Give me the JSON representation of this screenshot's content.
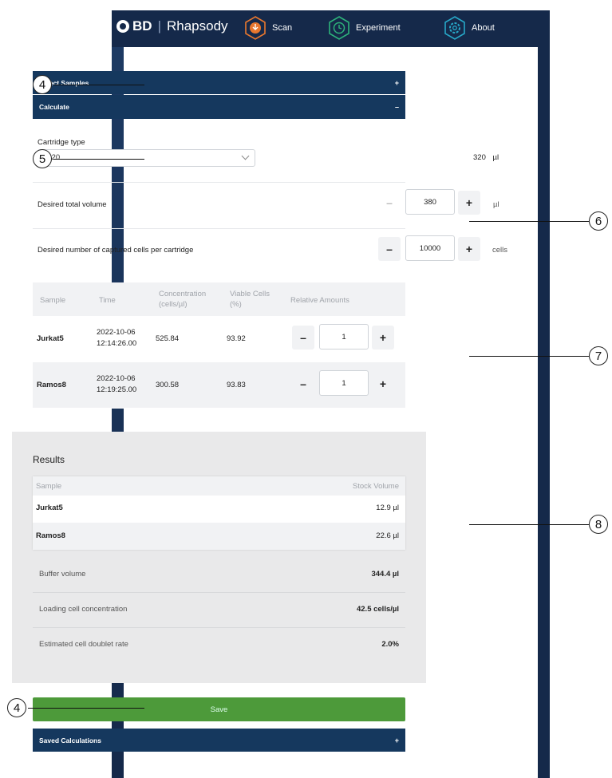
{
  "header": {
    "brand_bd": "BD",
    "brand_sep": "|",
    "brand_name": "Rhapsody",
    "nav": [
      {
        "label": "Scan",
        "color": "#e8772e",
        "icon": "scan-icon"
      },
      {
        "label": "Experiment",
        "color": "#2db37a",
        "icon": "experiment-icon"
      },
      {
        "label": "About",
        "color": "#27a7c7",
        "icon": "gear-icon"
      }
    ]
  },
  "accordion": {
    "select_samples": {
      "label": "Select Samples",
      "sign": "+"
    },
    "calculate": {
      "label": "Calculate",
      "sign": "–"
    },
    "saved_calculations": {
      "label": "Saved Calculations",
      "sign": "+"
    }
  },
  "calculate": {
    "cartridge_label": "Cartridge type",
    "cartridge_value": "0120",
    "cartridge_volume": "320",
    "cartridge_unit": "µl",
    "total_volume_label": "Desired total volume",
    "total_volume_minus": "–",
    "total_volume_value": "380",
    "total_volume_plus": "+",
    "total_volume_unit": "µl",
    "cells_label": "Desired number of captured cells per cartridge",
    "cells_minus": "–",
    "cells_value": "10000",
    "cells_plus": "+",
    "cells_unit": "cells"
  },
  "samples_table": {
    "headers": {
      "sample": "Sample",
      "time": "Time",
      "concentration_1": "Concentration",
      "concentration_2": "(cells/µl)",
      "viable_1": "Viable Cells",
      "viable_2": "(%)",
      "relative": "Relative Amounts"
    },
    "rows": [
      {
        "sample": "Jurkat5",
        "date": "2022-10-06",
        "time": "12:14:26.00",
        "concentration": "525.84",
        "viable": "93.92",
        "minus": "–",
        "amount": "1",
        "plus": "+"
      },
      {
        "sample": "Ramos8",
        "date": "2022-10-06",
        "time": "12:19:25.00",
        "concentration": "300.58",
        "viable": "93.83",
        "minus": "–",
        "amount": "1",
        "plus": "+"
      }
    ]
  },
  "results": {
    "title": "Results",
    "headers": {
      "sample": "Sample",
      "stock": "Stock Volume"
    },
    "rows": [
      {
        "sample": "Jurkat5",
        "stock": "12.9 µl"
      },
      {
        "sample": "Ramos8",
        "stock": "22.6 µl"
      }
    ],
    "buffer_label": "Buffer volume",
    "buffer_value": "344.4 µl",
    "loading_label": "Loading cell concentration",
    "loading_value": "42.5 cells/µl",
    "doublet_label": "Estimated cell doublet rate",
    "doublet_value": "2.0%"
  },
  "save_label": "Save",
  "callouts": {
    "c4_top": "4",
    "c5": "5",
    "c6": "6",
    "c7": "7",
    "c8": "8",
    "c4_bottom": "4"
  }
}
